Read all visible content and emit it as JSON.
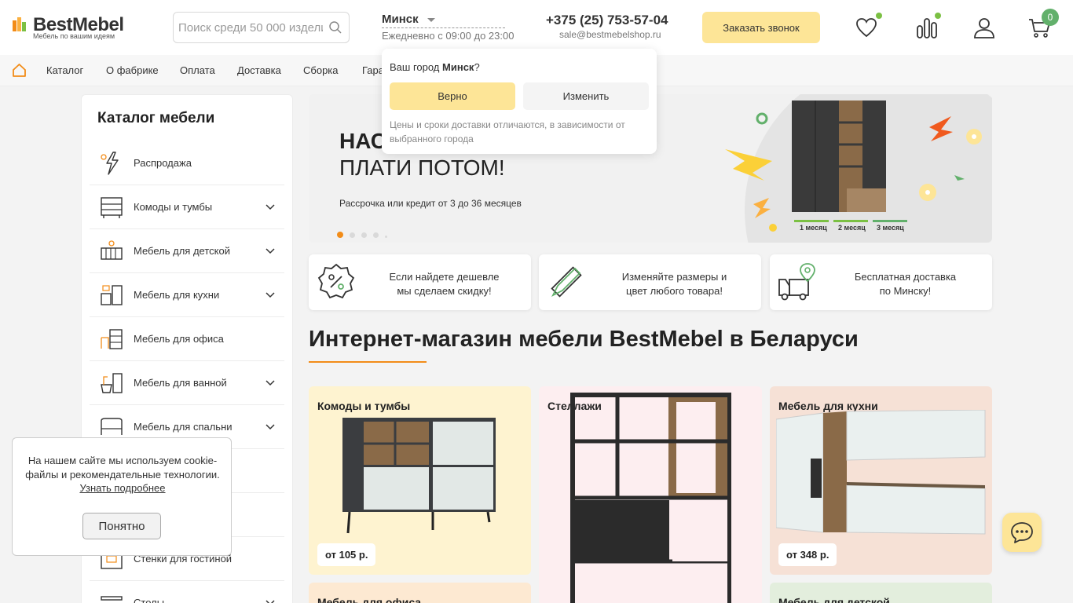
{
  "header": {
    "logo_text": "BestMebel",
    "logo_tagline": "Мебель по вашим идеям",
    "search_placeholder": "Поиск среди 50 000 изделий",
    "city": "Минск",
    "hours": "Ежедневно с 09:00 до 23:00",
    "phone": "+375 (25) 753-57-04",
    "email": "sale@bestmebelshop.ru",
    "callback_label": "Заказать звонок",
    "cart_count": "0",
    "icons": [
      "heart-icon",
      "compare-icon",
      "user-icon",
      "cart-icon"
    ]
  },
  "nav": {
    "items": [
      "Каталог",
      "О фабрике",
      "Оплата",
      "Доставка",
      "Сборка",
      "Гара"
    ]
  },
  "city_popup": {
    "question_prefix": "Ваш город",
    "city": "Минск",
    "question_suffix": "?",
    "confirm_label": "Верно",
    "change_label": "Изменить",
    "note": "Цены и сроки доставки отличаются, в зависимости от выбранного города"
  },
  "sidebar": {
    "title": "Каталог мебели",
    "items": [
      {
        "label": "Распродажа",
        "expandable": false,
        "icon": "sale-icon"
      },
      {
        "label": "Комоды и тумбы",
        "expandable": true,
        "icon": "dresser-icon"
      },
      {
        "label": "Мебель для детской",
        "expandable": true,
        "icon": "crib-icon"
      },
      {
        "label": "Мебель для кухни",
        "expandable": true,
        "icon": "kitchen-icon"
      },
      {
        "label": "Мебель для офиса",
        "expandable": false,
        "icon": "office-desk-icon"
      },
      {
        "label": "Мебель для ванной",
        "expandable": true,
        "icon": "bathroom-icon"
      },
      {
        "label": "Мебель для спальни",
        "expandable": true,
        "icon": "bed-icon"
      },
      {
        "label": "",
        "expandable": false,
        "icon": "hallway-icon"
      },
      {
        "label": "",
        "expandable": false,
        "icon": "shelf-icon"
      },
      {
        "label": "Стенки для гостиной",
        "expandable": false,
        "icon": "wall-unit-icon"
      },
      {
        "label": "Столы",
        "expandable": true,
        "icon": "table-icon"
      }
    ]
  },
  "banner": {
    "title_line1": "НАС",
    "title_line2": "ПЛАТИ ПОТОМ!",
    "subtitle": "Рассрочка или кредит от 3 до 36 месяцев",
    "months": [
      "1 месяц",
      "2 месяц",
      "3 месяц"
    ],
    "slides_count": 5,
    "active_slide": 0,
    "accent_color": "#f28c18"
  },
  "features": [
    {
      "text_line1": "Если найдете дешевле",
      "text_line2": "мы сделаем скидку!",
      "icon": "percent-badge-icon"
    },
    {
      "text_line1": "Изменяйте размеры и",
      "text_line2": "цвет любого товара!",
      "icon": "pencil-ruler-icon"
    },
    {
      "text_line1": "Бесплатная доставка",
      "text_line2": "по Минску!",
      "icon": "delivery-truck-icon"
    }
  ],
  "main": {
    "heading": "Интернет-магазин мебели BestMebel в Беларуси"
  },
  "cards": [
    {
      "title": "Комоды и тумбы",
      "price": "от 105 р.",
      "bg": "#fef3d0"
    },
    {
      "title": "Стеллажи",
      "price": "",
      "bg": "#fdeef0"
    },
    {
      "title": "Мебель для кухни",
      "price": "от 348 р.",
      "bg": "#f6e1d6"
    },
    {
      "title": "Мебель для офиса",
      "price": "",
      "bg": "#fde9d2"
    },
    {
      "title": "Мебель для детской",
      "price": "",
      "bg": "#e3eedd"
    }
  ],
  "cookie": {
    "text": "На нашем сайте мы используем cookie-файлы и рекомендательные технологии.",
    "link": "Узнать подробнее",
    "button": "Понятно"
  },
  "chat": {
    "icon": "chat-bubble-icon"
  }
}
